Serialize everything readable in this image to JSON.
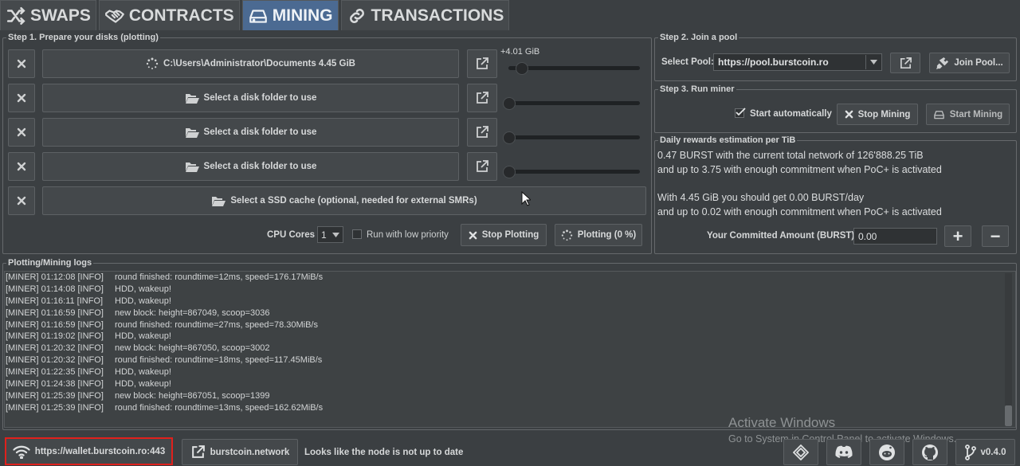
{
  "tabs": [
    {
      "label": "SWAPS",
      "icon": "shuffle-icon"
    },
    {
      "label": "CONTRACTS",
      "icon": "handshake-icon"
    },
    {
      "label": "MINING",
      "icon": "hard-drive-icon",
      "active": true
    },
    {
      "label": "TRANSACTIONS",
      "icon": "link-icon"
    }
  ],
  "step1": {
    "title": "Step 1. Prepare your disks (plotting)",
    "disks": [
      {
        "label": "C:\\Users\\Administrator\\Documents 4.45 GiB",
        "slider_label": "+4.01 GiB"
      },
      {
        "label": "Select a disk folder to use",
        "slider_label": ""
      },
      {
        "label": "Select a disk folder to use",
        "slider_label": ""
      },
      {
        "label": "Select a disk folder to use",
        "slider_label": ""
      }
    ],
    "ssd_label": "Select a SSD cache (optional, needed for external SMRs)",
    "cpu_cores_label": "CPU Cores",
    "cpu_cores_value": "1",
    "low_priority_label": "Run with low priority",
    "stop_plotting_label": "Stop Plotting",
    "plotting_label": "Plotting (0 %)"
  },
  "step2": {
    "title": "Step 2. Join a pool",
    "select_pool_label": "Select Pool:",
    "pool_value": "https://pool.burstcoin.ro",
    "join_pool_label": "Join Pool..."
  },
  "step3": {
    "title": "Step 3. Run miner",
    "start_auto_label": "Start automatically",
    "stop_mining_label": "Stop Mining",
    "start_mining_label": "Start Mining"
  },
  "rewards": {
    "title": "Daily rewards estimation per TiB",
    "line1": "0.47 BURST with the current total network of 126'888.25 TiB",
    "line2": "and up to 3.75 with enough commitment when PoC+ is activated",
    "line3": "With 4.45 GiB you should get 0.00 BURST/day",
    "line4": "and up to 0.02 with enough commitment when PoC+ is activated",
    "committed_label": "Your Committed Amount (BURST):",
    "committed_value": "0.00",
    "plus_label": "+",
    "minus_label": "−"
  },
  "logs": {
    "title": "Plotting/Mining logs",
    "lines": [
      {
        "tag": "[MINER] 01:12:08 [INFO]",
        "msg": "round finished: roundtime=12ms, speed=176.17MiB/s"
      },
      {
        "tag": "[MINER] 01:14:08 [INFO]",
        "msg": "HDD, wakeup!"
      },
      {
        "tag": "[MINER] 01:16:11 [INFO]",
        "msg": "HDD, wakeup!"
      },
      {
        "tag": "[MINER] 01:16:59 [INFO]",
        "msg": "new block: height=867049, scoop=3036"
      },
      {
        "tag": "[MINER] 01:16:59 [INFO]",
        "msg": "round finished: roundtime=27ms, speed=78.30MiB/s"
      },
      {
        "tag": "[MINER] 01:19:02 [INFO]",
        "msg": "HDD, wakeup!"
      },
      {
        "tag": "[MINER] 01:20:32 [INFO]",
        "msg": "new block: height=867050, scoop=3002"
      },
      {
        "tag": "[MINER] 01:20:32 [INFO]",
        "msg": "round finished: roundtime=18ms, speed=117.45MiB/s"
      },
      {
        "tag": "[MINER] 01:22:35 [INFO]",
        "msg": "HDD, wakeup!"
      },
      {
        "tag": "[MINER] 01:24:38 [INFO]",
        "msg": "HDD, wakeup!"
      },
      {
        "tag": "[MINER] 01:25:39 [INFO]",
        "msg": "new block: height=867051, scoop=1399"
      },
      {
        "tag": "[MINER] 01:25:39 [INFO]",
        "msg": "round finished: roundtime=13ms, speed=162.62MiB/s"
      }
    ]
  },
  "watermark": {
    "title": "Activate Windows",
    "subtitle": "Go to System in Control Panel to activate Windows."
  },
  "footer": {
    "node_url": "https://wallet.burstcoin.ro:443",
    "network_label": "burstcoin.network",
    "status_text": "Looks like the node is not up to date",
    "version": "v0.4.0"
  },
  "colors": {
    "background": "#3b3f42",
    "active_tab": "#4b6a92",
    "highlight_border": "#e0201c"
  }
}
